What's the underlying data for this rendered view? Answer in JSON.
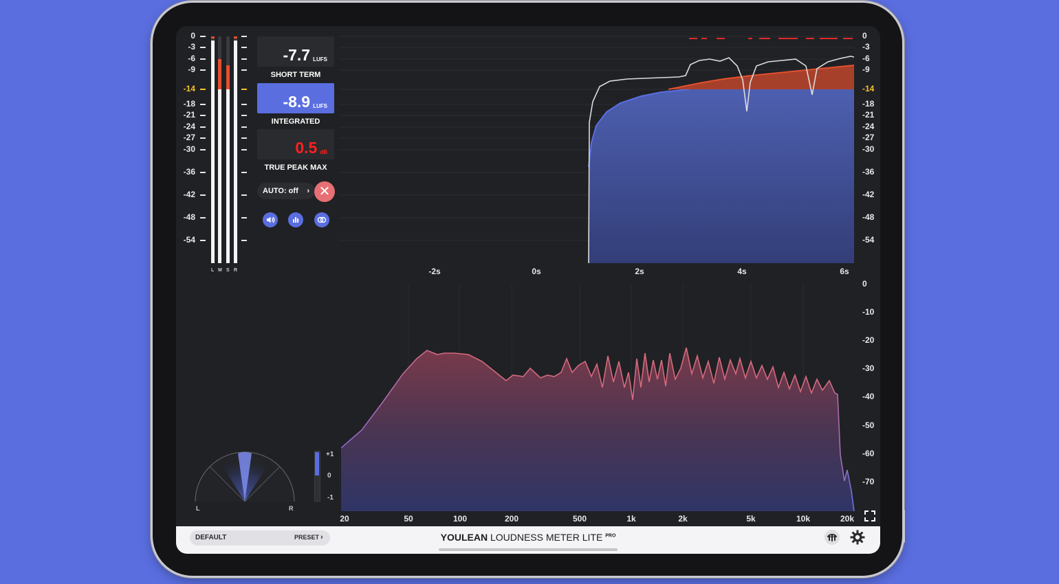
{
  "meter": {
    "ticks": [
      "0",
      "-3",
      "-6",
      "-9",
      "-14",
      "-18",
      "-21",
      "-24",
      "-27",
      "-30",
      "-36",
      "-42",
      "-48",
      "-54"
    ],
    "reference_tick": "-14",
    "channels": [
      "L",
      "M",
      "S",
      "R"
    ]
  },
  "readouts": {
    "short_term": {
      "value": "-7.7",
      "unit": "LUFS",
      "label": "SHORT TERM"
    },
    "integrated": {
      "value": "-8.9",
      "unit": "LUFS",
      "label": "INTEGRATED"
    },
    "true_peak": {
      "value": "0.5",
      "unit": "dB",
      "label": "TRUE PEAK MAX"
    }
  },
  "controls": {
    "auto_label": "AUTO: off",
    "auto_chevron": "›",
    "close_glyph": "✕",
    "speaker_icon": "🔊",
    "chart_icon": "▮▮",
    "link_icon": "∞"
  },
  "loudness_graph": {
    "y_ticks": [
      "0",
      "-3",
      "-6",
      "-9",
      "-14",
      "-18",
      "-21",
      "-24",
      "-27",
      "-30",
      "-36",
      "-42",
      "-48",
      "-54"
    ],
    "x_ticks": [
      "-2s",
      "0s",
      "2s",
      "4s",
      "6s"
    ]
  },
  "spectrum": {
    "y_ticks": [
      "0",
      "-10",
      "-20",
      "-30",
      "-40",
      "-50",
      "-60",
      "-70"
    ],
    "x_ticks": [
      "20",
      "50",
      "100",
      "200",
      "500",
      "1k",
      "2k",
      "5k",
      "10k",
      "20k"
    ]
  },
  "correlation": {
    "ticks": [
      "+1",
      "0",
      "-1"
    ]
  },
  "goniometer": {
    "left": "L",
    "right": "R"
  },
  "footer": {
    "preset_name": "DEFAULT",
    "preset_button": "PRESET",
    "preset_chevron": "›",
    "brand_bold": "YOULEAN",
    "brand_rest": " LOUDNESS METER LITE ",
    "brand_sup": "PRO"
  },
  "colors": {
    "accent": "#5a6ee0",
    "peak_red": "#ff2020",
    "reference_yellow": "#f3c230",
    "loudness_fill_blue": "#3f4f9a",
    "loudness_fill_red": "#c0432a",
    "spectrum_line": "#d56a7e"
  }
}
